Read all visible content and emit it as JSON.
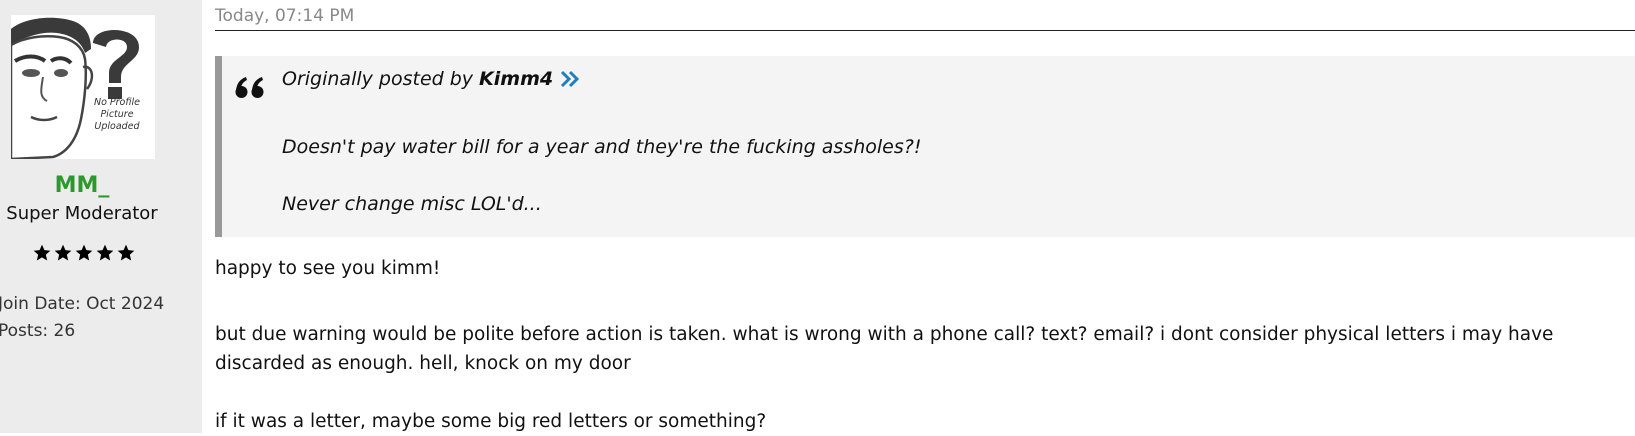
{
  "user": {
    "avatar_caption": "No Profile Picture Uploaded",
    "username": "MM_",
    "title": "Super Moderator",
    "stars": 5,
    "join_date": "Join Date: Oct 2024",
    "posts": "Posts: 26"
  },
  "post": {
    "timestamp": "Today, 07:14 PM",
    "quote": {
      "prefix": "Originally posted by",
      "author": "Kimm4",
      "lines": [
        "Doesn't pay water bill for a year and they're the fucking assholes?!",
        "Never change misc LOL'd..."
      ]
    },
    "paragraphs": [
      "happy to see you kimm!",
      "but due warning would be polite before action is taken. what is wrong with a phone call? text? email? i dont consider physical letters i may have discarded as enough. hell, knock on my door",
      "if it was a letter, maybe some big red letters or something?"
    ]
  },
  "colors": {
    "username": "#2a9a2a",
    "sidebar_bg": "#ececec",
    "quote_bg": "#f4f4f4",
    "quote_border": "#999999",
    "jump_icon": "#1f7fc0"
  },
  "icons": {
    "avatar": "no-profile-picture-icon",
    "quote": "quote-mark-icon",
    "jump": "double-chevron-right-icon",
    "star": "star-icon"
  }
}
